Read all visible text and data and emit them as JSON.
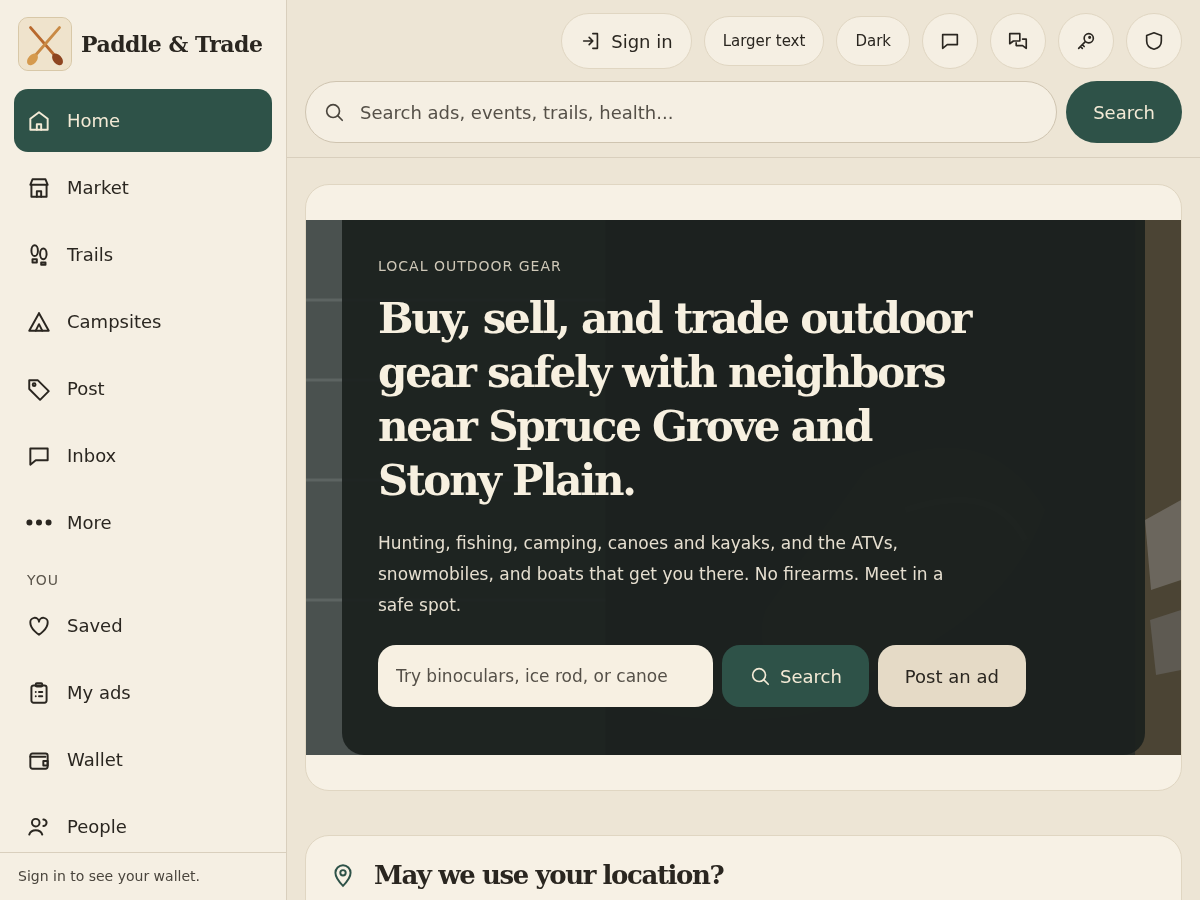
{
  "brand": {
    "name": "Paddle & Trade"
  },
  "sidebar": {
    "items": [
      {
        "label": "Home",
        "selected": true
      },
      {
        "label": "Market",
        "selected": false
      },
      {
        "label": "Trails",
        "selected": false
      },
      {
        "label": "Campsites",
        "selected": false
      },
      {
        "label": "Post",
        "selected": false
      },
      {
        "label": "Inbox",
        "selected": false
      },
      {
        "label": "More",
        "selected": false
      }
    ],
    "section": "YOU",
    "section_items": [
      {
        "label": "Saved",
        "selected": false
      },
      {
        "label": "My ads",
        "selected": false
      },
      {
        "label": "Wallet",
        "selected": false
      },
      {
        "label": "People",
        "selected": false
      }
    ],
    "footer": "Sign in to see your wallet."
  },
  "toolbar": {
    "buttons": [
      {
        "kind": "text",
        "label": "Sign in",
        "icon": true
      },
      {
        "kind": "text",
        "label": "Larger text",
        "icon": false
      },
      {
        "kind": "text",
        "label": "Dark",
        "icon": false
      },
      {
        "kind": "icon"
      },
      {
        "kind": "icon"
      },
      {
        "kind": "icon"
      },
      {
        "kind": "icon"
      }
    ],
    "search": {
      "placeholder": "Search ads, events, trails, health...",
      "button": "Search"
    }
  },
  "hero": {
    "eyebrow": "LOCAL OUTDOOR GEAR",
    "title": "Buy, sell, and trade outdoor gear safely with neighbors near Spruce Grove and Stony Plain.",
    "body": "Hunting, fishing, camping, canoes and kayaks, and the ATVs, snowmobiles, and boats that get you there. No firearms. Meet in a safe spot.",
    "search": {
      "placeholder": "Try binoculars, ice rod, or canoe",
      "button": "Search"
    },
    "post_button": "Post an ad"
  },
  "location": {
    "title": "May we use your location?"
  }
}
